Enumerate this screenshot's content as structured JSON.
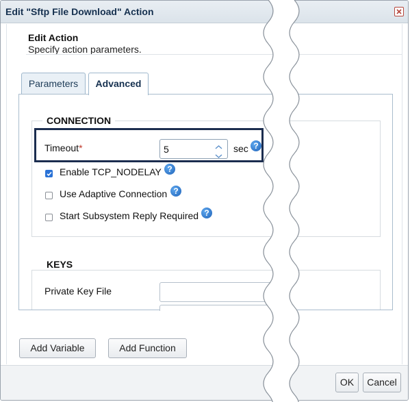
{
  "window": {
    "title": "Edit \"Sftp File Download\" Action"
  },
  "header": {
    "title": "Edit Action",
    "subtitle": "Specify action parameters."
  },
  "tabs": [
    {
      "label": "Parameters",
      "active": false
    },
    {
      "label": "Advanced",
      "active": true
    }
  ],
  "connection": {
    "legend": "CONNECTION",
    "timeout_label": "Timeout",
    "required_mark": "*",
    "timeout_value": "5",
    "timeout_unit": "sec",
    "checkboxes": [
      {
        "label": "Enable TCP_NODELAY",
        "checked": true
      },
      {
        "label": "Use Adaptive Connection",
        "checked": false
      },
      {
        "label": "Start Subsystem Reply Required",
        "checked": false
      }
    ]
  },
  "keys": {
    "legend": "KEYS",
    "private_key_label": "Private Key File",
    "private_key_value": ""
  },
  "buttons": {
    "add_variable": "Add Variable",
    "add_function": "Add Function",
    "ok": "OK",
    "cancel": "Cancel"
  },
  "icons": {
    "close": "close-icon",
    "help": "help-icon",
    "spin_up": "chevron-up-icon",
    "spin_down": "chevron-down-icon"
  },
  "colors": {
    "accent": "#1f62b8",
    "highlight_border": "#1b2d4f",
    "required": "#c0392b"
  }
}
